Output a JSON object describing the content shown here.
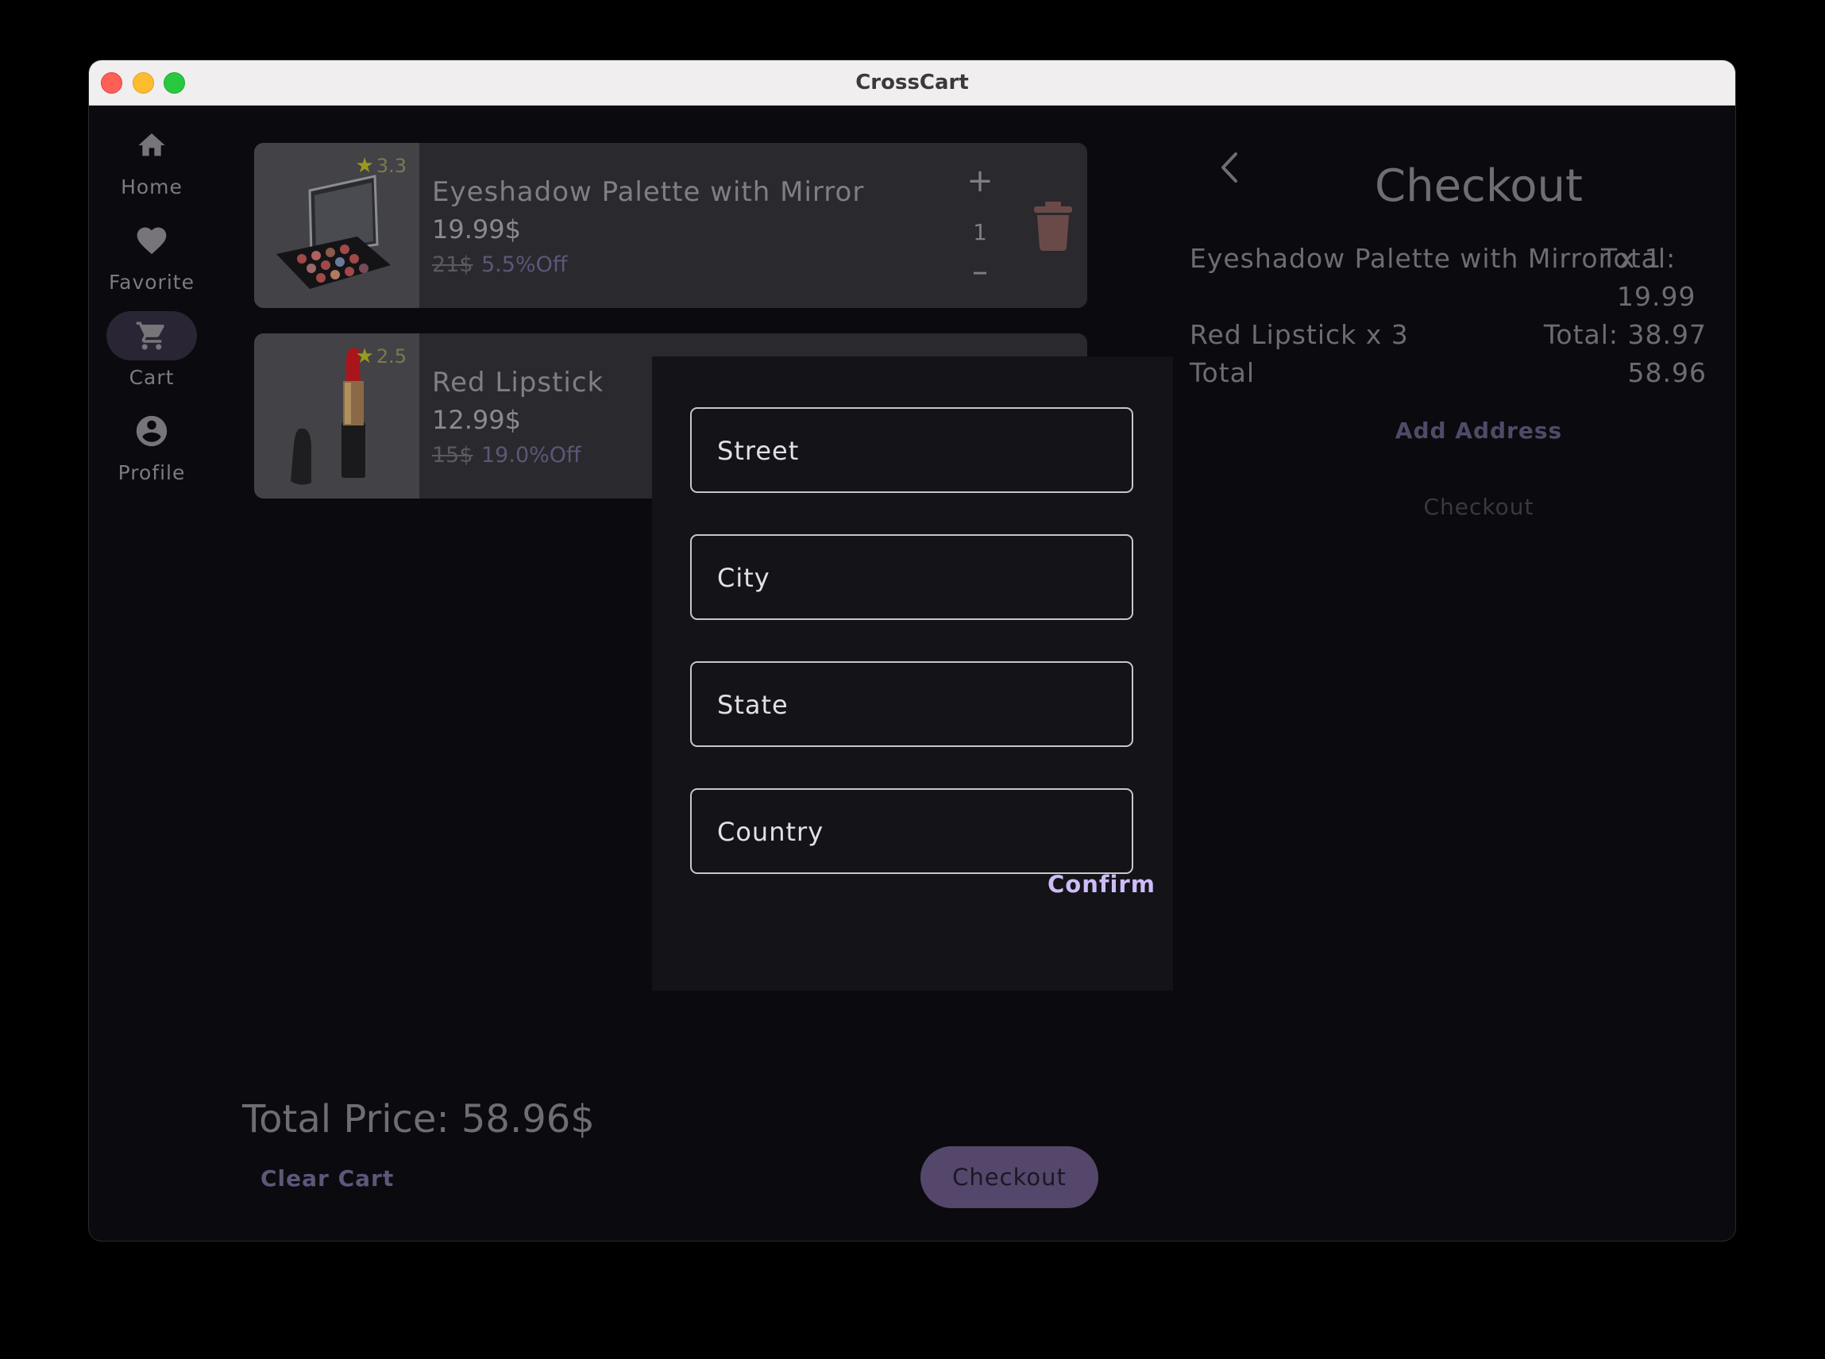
{
  "window": {
    "title": "CrossCart"
  },
  "nav": {
    "items": [
      {
        "label": "Home",
        "icon": "home-icon"
      },
      {
        "label": "Favorite",
        "icon": "heart-icon"
      },
      {
        "label": "Cart",
        "icon": "cart-icon",
        "active": true
      },
      {
        "label": "Profile",
        "icon": "account-circle-icon"
      }
    ]
  },
  "cart": {
    "items": [
      {
        "name": "Eyeshadow Palette with Mirror",
        "rating": "3.3",
        "price": "19.99$",
        "old_price": "21$",
        "discount": "5.5%Off",
        "quantity": "1",
        "plus": "+",
        "minus": "–"
      },
      {
        "name": "Red Lipstick",
        "rating": "2.5",
        "price": "12.99$",
        "old_price": "15$",
        "discount": "19.0%Off"
      }
    ],
    "total_price": "Total Price: 58.96$",
    "clear_label": "Clear Cart",
    "checkout_label": "Checkout"
  },
  "checkout": {
    "title": "Checkout",
    "line1_name": "Eyeshadow Palette with Mirror x 1",
    "line1_total_label": "Total:",
    "line1_total_value": "19.99",
    "line2_name": "Red Lipstick x 3",
    "line2_total": "Total: 38.97",
    "total_label": "Total",
    "total_value": "58.96",
    "add_address": "Add Address",
    "checkout_label": "Checkout"
  },
  "dialog": {
    "street_placeholder": "Street",
    "city_placeholder": "City",
    "state_placeholder": "State",
    "country_placeholder": "Country",
    "confirm_label": "Confirm"
  },
  "colors": {
    "accent": "#cdbcf7",
    "checkout_button": "#55476b",
    "background": "#0b0a0e",
    "star": "#9a9a1e"
  }
}
